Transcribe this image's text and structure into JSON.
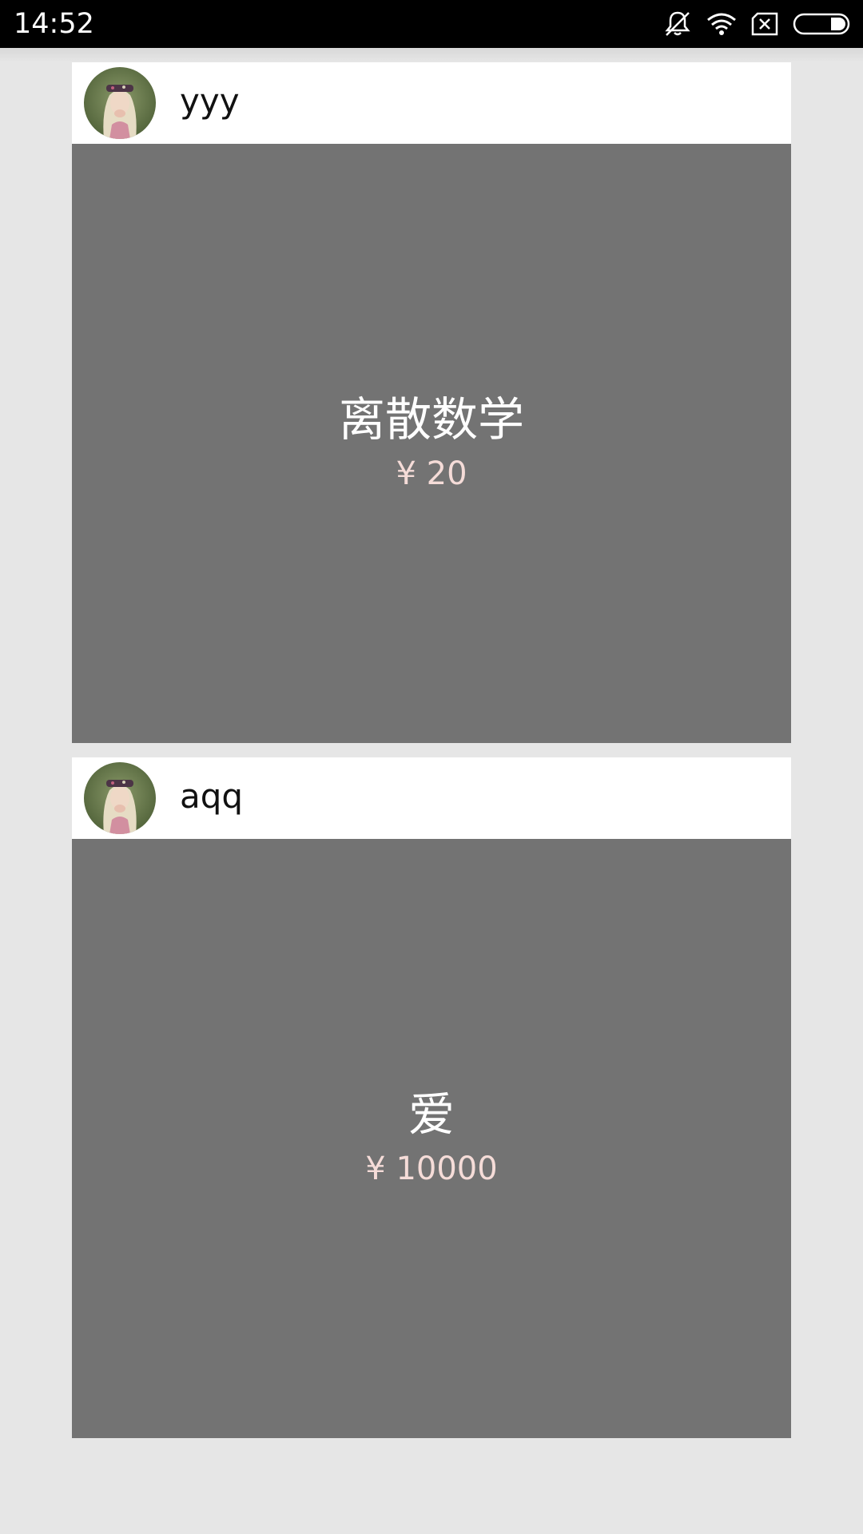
{
  "status_bar": {
    "time": "14:52",
    "icons": [
      "notifications-muted-icon",
      "wifi-icon",
      "no-sim-icon",
      "battery-icon"
    ]
  },
  "listings": [
    {
      "username": "yyy",
      "avatar": "avatar-icon",
      "title": "离散数学",
      "price": "¥ 20"
    },
    {
      "username": "aqq",
      "avatar": "avatar-icon",
      "title": "爱",
      "price": "¥ 10000"
    }
  ],
  "colors": {
    "status_bar": "#000000",
    "page_background": "#e6e6e6",
    "card_body": "#737373",
    "price_text": "#f5dcd8"
  }
}
